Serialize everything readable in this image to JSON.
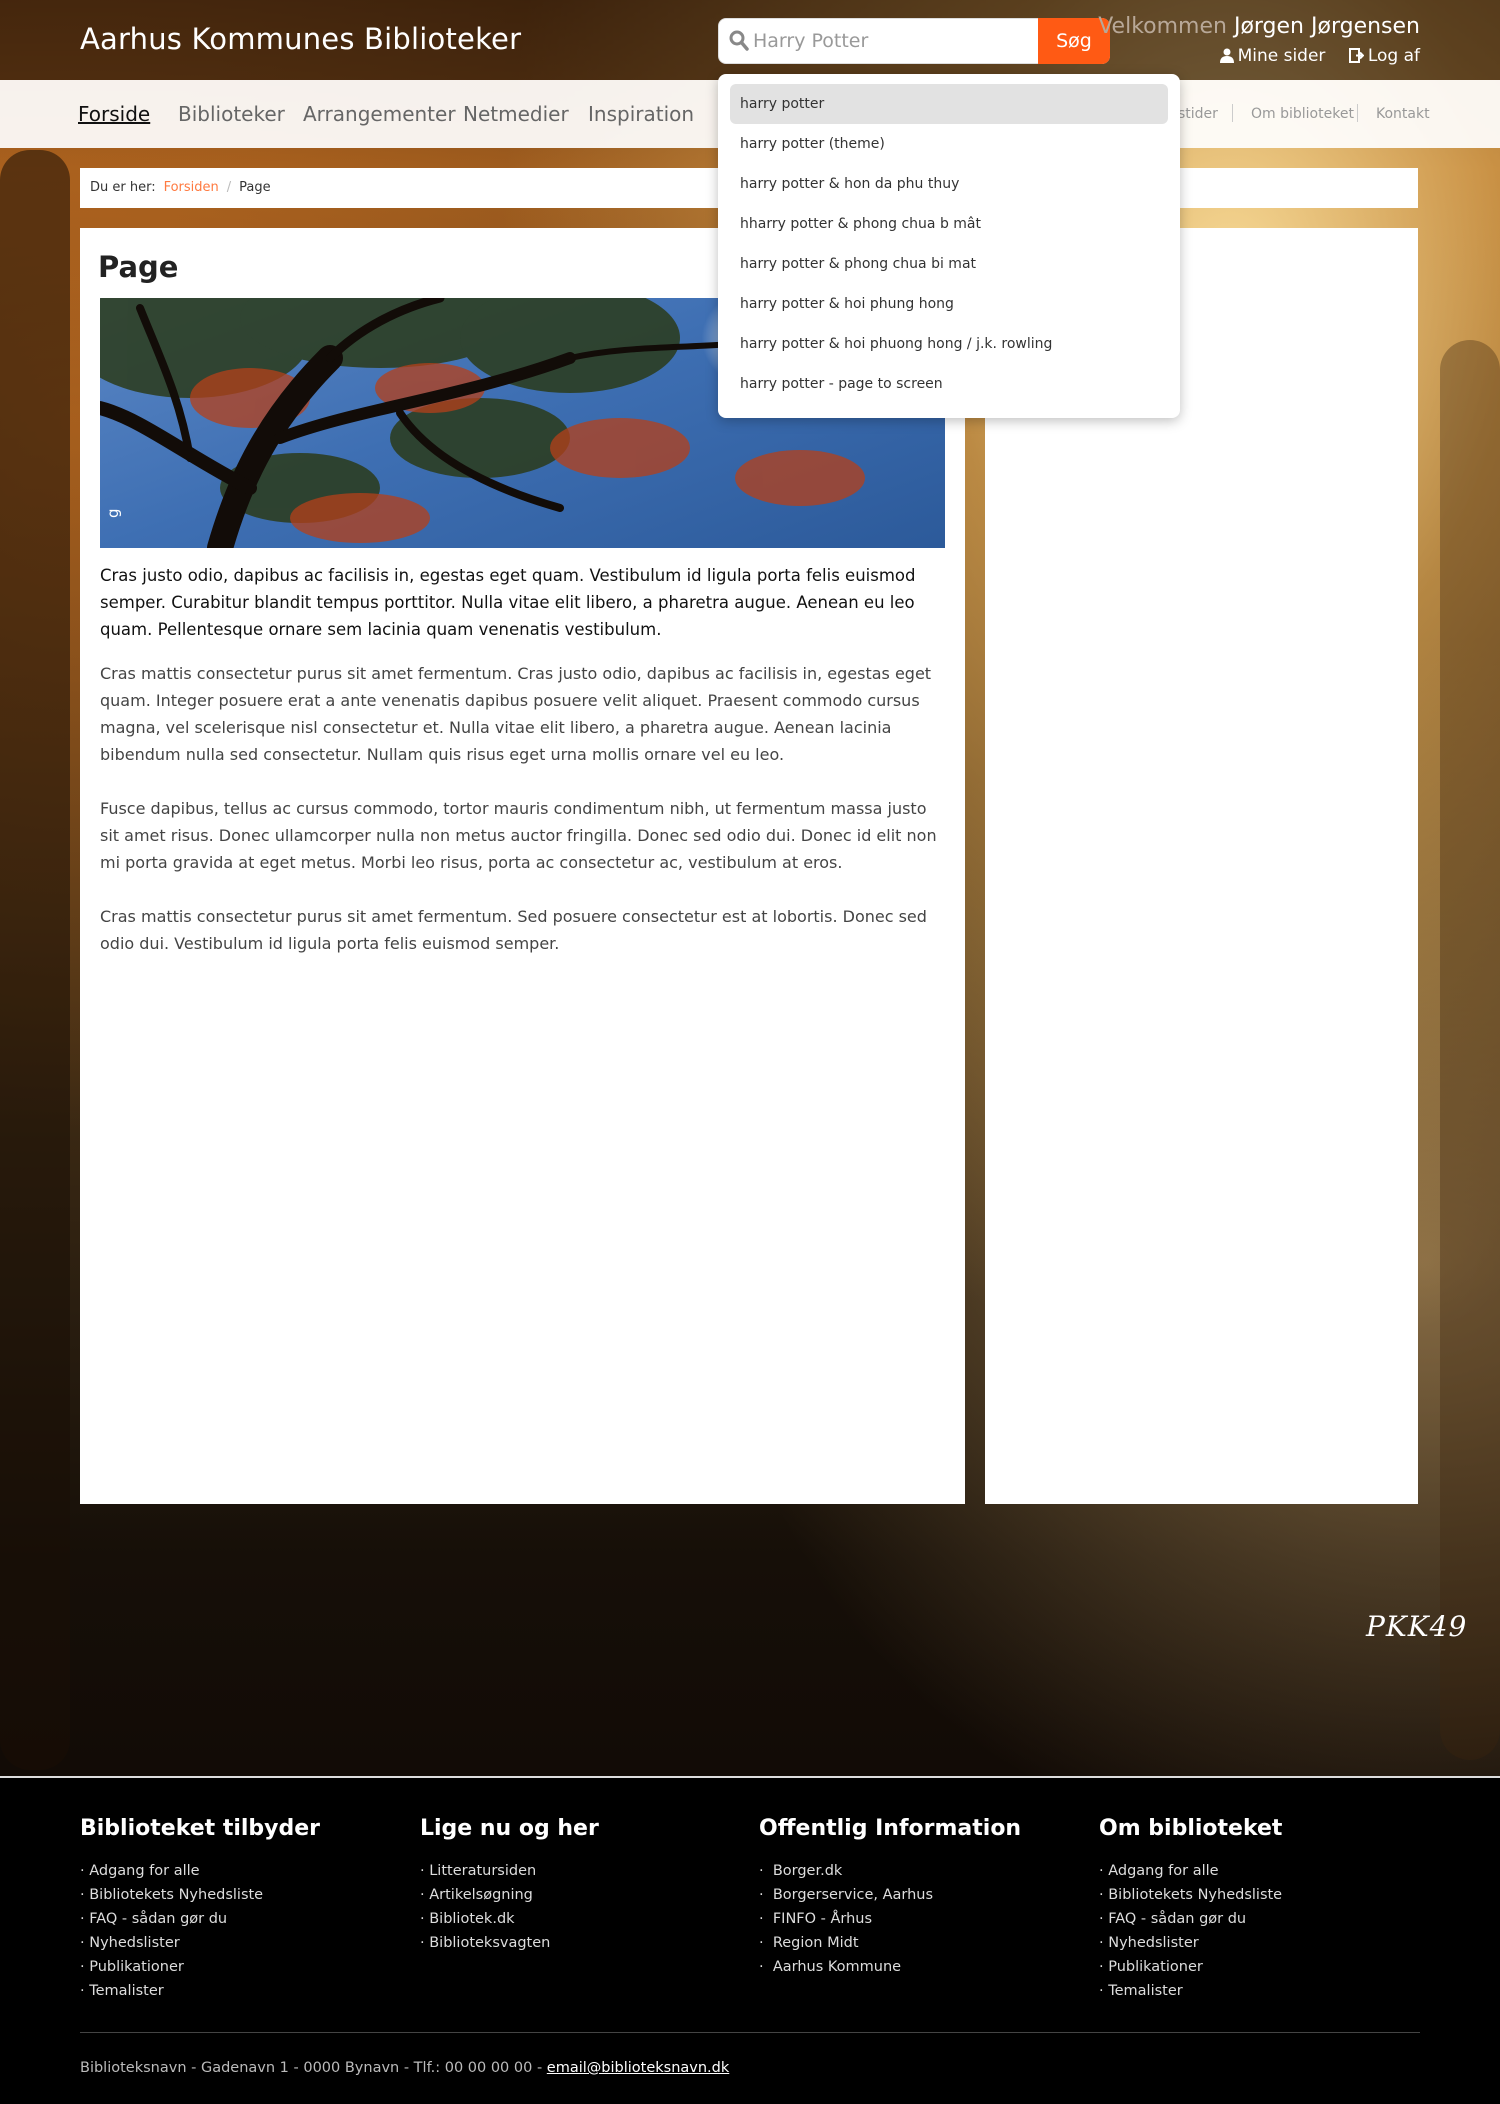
{
  "header": {
    "site_title": "Aarhus Kommunes Biblioteker",
    "search_value": "Harry Potter",
    "search_button": "Søg",
    "welcome_label": "Velkommen",
    "user_name": "Jørgen Jørgensen",
    "my_pages": "Mine sider",
    "logout": "Log af"
  },
  "nav": {
    "items": [
      "Forside",
      "Biblioteker",
      "Arrangementer",
      "Netmedier",
      "Inspiration"
    ],
    "active": "Forside",
    "secondary": [
      "stider",
      "Om biblioteket",
      "Kontakt"
    ]
  },
  "breadcrumb": {
    "prefix": "Du er her:",
    "home": "Forsiden",
    "separator": "/",
    "current": "Page"
  },
  "content": {
    "title": "Page",
    "lead": "Cras justo odio, dapibus ac facilisis in, egestas eget quam. Vestibulum id ligula porta felis euismod semper. Curabitur blandit tempus porttitor. Nulla vitae elit libero, a pharetra augue. Aenean eu leo quam. Pellentesque ornare sem lacinia quam venenatis vestibulum.",
    "paragraphs": [
      "Cras mattis consectetur purus sit amet fermentum. Cras justo odio, dapibus ac facilisis in, egestas eget quam. Integer posuere erat a ante venenatis dapibus posuere velit aliquet. Praesent commodo cursus magna, vel scelerisque nisl consectetur et. Nulla vitae elit libero, a pharetra augue. Aenean lacinia bibendum nulla sed consectetur. Nullam quis risus eget urna mollis ornare vel eu leo.",
      "Fusce dapibus, tellus ac cursus commodo, tortor mauris condimentum nibh, ut fermentum massa justo sit amet risus. Donec ullamcorper nulla non metus auctor fringilla. Donec sed odio dui. Donec id elit non mi porta gravida at eget metus. Morbi leo risus, porta ac consectetur ac, vestibulum at eros.",
      "Cras mattis consectetur purus sit amet fermentum. Sed posuere consectetur est at lobortis. Donec sed odio dui. Vestibulum id ligula porta felis euismod semper."
    ],
    "image_caption_glyph": "g"
  },
  "autocomplete": {
    "suggestions": [
      "harry potter",
      "harry potter (theme)",
      "harry potter & hon da phu thuy",
      "hharry potter & phong chua b mât",
      "harry potter & phong chua bi mat",
      "harry potter & hoi phung hong",
      "harry potter & hoi phuong hong / j.k. rowling",
      "harry potter - page to screen"
    ],
    "active_index": 0
  },
  "signature": "PKK49",
  "footer": {
    "columns": [
      {
        "heading": "Biblioteket tilbyder",
        "items": [
          "Adgang for alle",
          "Bibliotekets Nyhedsliste",
          "FAQ - sådan gør du",
          "Nyhedslister",
          "Publikationer",
          "Temalister"
        ]
      },
      {
        "heading": "Lige nu og her",
        "items": [
          "Litteratursiden",
          "Artikelsøgning",
          "Bibliotek.dk",
          "Biblioteksvagten"
        ]
      },
      {
        "heading": "Offentlig Information",
        "items": [
          "Borger.dk",
          "Borgerservice, Aarhus",
          "FINFO - Århus",
          "Region Midt",
          "Aarhus Kommune"
        ]
      },
      {
        "heading": "Om biblioteket",
        "items": [
          "Adgang for alle",
          "Bibliotekets Nyhedsliste",
          "FAQ - sådan gør du",
          "Nyhedslister",
          "Publikationer",
          "Temalister"
        ]
      }
    ],
    "address": "Biblioteksnavn - Gadenavn 1 - 0000 Bynavn - Tlf.: 00 00 00 00 -",
    "email": "email@biblioteksnavn.dk"
  },
  "colors": {
    "accent": "#ff5a14",
    "breadcrumb_link": "#ff7a40",
    "footer_bg": "#000000"
  },
  "icons": [
    "search-icon",
    "user-icon",
    "logout-icon"
  ]
}
